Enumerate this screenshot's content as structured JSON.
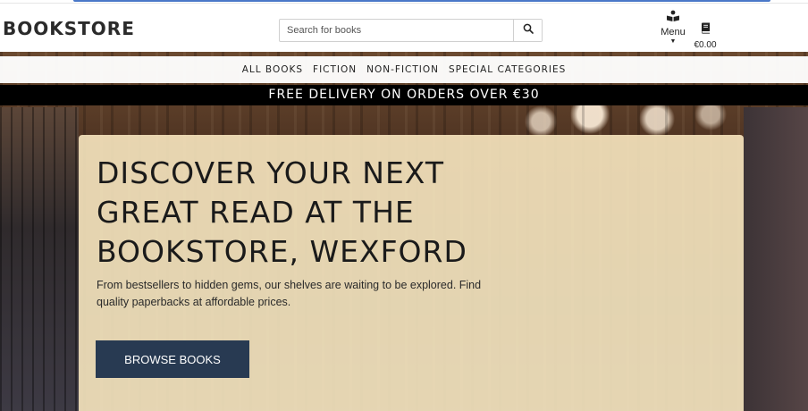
{
  "header": {
    "logo": "BOOKSTORE",
    "search": {
      "placeholder": "Search for books",
      "value": ""
    },
    "menu_label": "Menu",
    "cart_total": "€0.00"
  },
  "nav": {
    "items": [
      {
        "label": "ALL BOOKS"
      },
      {
        "label": "FICTION"
      },
      {
        "label": "NON-FICTION"
      },
      {
        "label": "SPECIAL CATEGORIES"
      }
    ]
  },
  "banner": {
    "text": "FREE DELIVERY ON ORDERS OVER €30"
  },
  "hero": {
    "title_lines": [
      "DISCOVER YOUR NEXT",
      "GREAT READ AT THE",
      "BOOKSTORE, WEXFORD"
    ],
    "subtitle": "From bestsellers to hidden gems, our shelves are waiting to be explored. Find quality paperbacks at affordable prices.",
    "cta_label": "BROWSE BOOKS"
  },
  "colors": {
    "cta_background": "#283a52",
    "banner_background": "#000000",
    "hero_card": "#fdecc4"
  },
  "icons": {
    "search": "search-icon",
    "menu": "reader-icon",
    "caret": "caret-down-icon",
    "cart": "book-icon"
  }
}
